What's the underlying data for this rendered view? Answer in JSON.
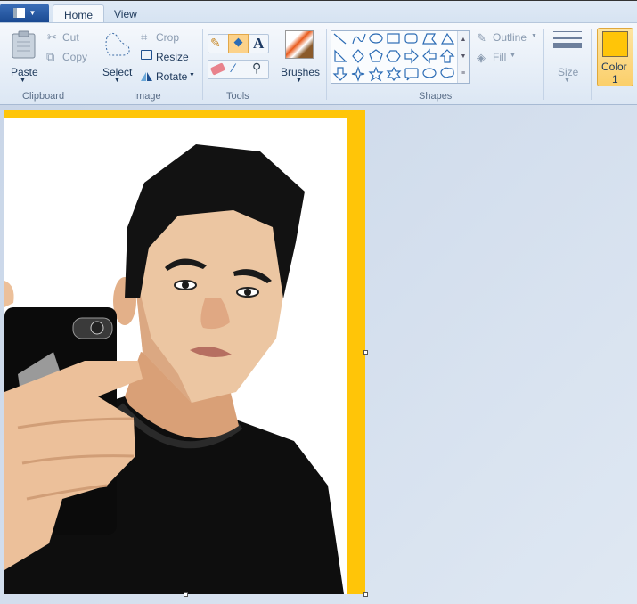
{
  "tabs": {
    "app_menu_icon": "menu-icon",
    "home": "Home",
    "view": "View"
  },
  "clipboard": {
    "paste": "Paste",
    "cut": "Cut",
    "copy": "Copy",
    "label": "Clipboard"
  },
  "image": {
    "select": "Select",
    "crop": "Crop",
    "resize": "Resize",
    "rotate": "Rotate",
    "label": "Image"
  },
  "tools": {
    "label": "Tools",
    "items": [
      "pencil",
      "fill",
      "text",
      "eraser",
      "color-picker",
      "magnifier"
    ]
  },
  "brushes": {
    "label": "Brushes"
  },
  "shapes": {
    "label": "Shapes",
    "outline": "Outline",
    "fill": "Fill"
  },
  "size": {
    "label": "Size"
  },
  "color1": {
    "label": "Color",
    "number": "1",
    "value": "#ffc508"
  },
  "canvas": {
    "background": "#ffc508"
  }
}
